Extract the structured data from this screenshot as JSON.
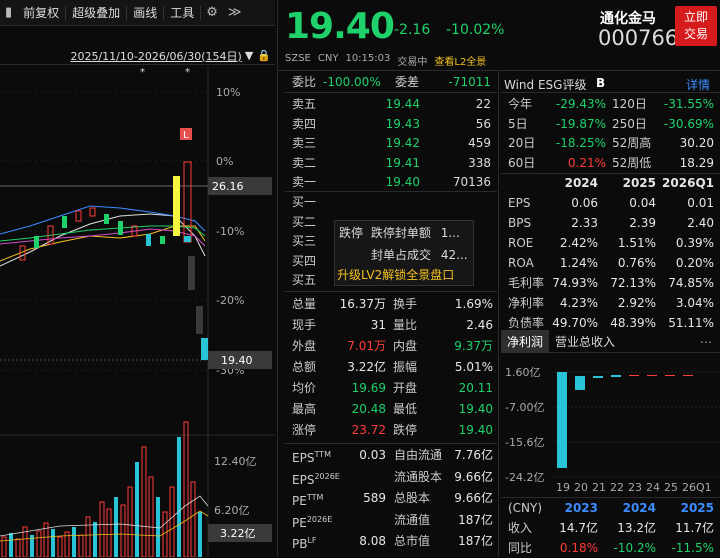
{
  "toolbar": {
    "items": [
      "前复权",
      "超级叠加",
      "画线",
      "工具"
    ],
    "gear": "⚙",
    "collapse": "≫"
  },
  "chart": {
    "range_label": "2025/11/10-2026/06/30(154日)",
    "y_labels": [
      "10%",
      "0%",
      "-10%",
      "-20%",
      "-30%"
    ],
    "price_tags": [
      "26.16",
      "19.40"
    ],
    "vol_labels": [
      "12.40亿",
      "6.20亿",
      "3.22亿"
    ],
    "marker": "L",
    "star": "*"
  },
  "quote": {
    "price": "19.40",
    "change": "-2.16",
    "change_pct": "-10.02%",
    "name": "通化金马",
    "code": "000766",
    "trade_btn": [
      "立即",
      "交易"
    ],
    "sub": [
      "SZSE",
      "CNY",
      "10:15:03",
      "交易中",
      "查看L2全景"
    ]
  },
  "book": {
    "weibi_label": "委比",
    "weibi": "-100.00%",
    "weicha_label": "委差",
    "weicha": "-71011",
    "asks": [
      {
        "label": "卖五",
        "price": "19.44",
        "vol": "22"
      },
      {
        "label": "卖四",
        "price": "19.43",
        "vol": "56"
      },
      {
        "label": "卖三",
        "price": "19.42",
        "vol": "459"
      },
      {
        "label": "卖二",
        "price": "19.41",
        "vol": "338"
      },
      {
        "label": "卖一",
        "price": "19.40",
        "vol": "70136"
      }
    ],
    "bids": [
      "买一",
      "买二",
      "买三",
      "买四",
      "买五"
    ],
    "popup": {
      "l1a": "跌停",
      "l1b": "跌停封单额",
      "l1c": "1...",
      "l2a": "封单占成交",
      "l2b": "42...",
      "l3": "升级LV2解锁全景盘口"
    }
  },
  "stats": [
    {
      "k1": "总量",
      "v1": "16.37万",
      "c1": "white",
      "k2": "换手",
      "v2": "1.69%",
      "c2": "white"
    },
    {
      "k1": "现手",
      "v1": "31",
      "c1": "white",
      "k2": "量比",
      "v2": "2.46",
      "c2": "white"
    },
    {
      "k1": "外盘",
      "v1": "7.01万",
      "c1": "red",
      "k2": "内盘",
      "v2": "9.37万",
      "c2": "green"
    },
    {
      "k1": "总额",
      "v1": "3.22亿",
      "c1": "white",
      "k2": "振幅",
      "v2": "5.01%",
      "c2": "white"
    },
    {
      "k1": "均价",
      "v1": "19.69",
      "c1": "green",
      "k2": "开盘",
      "v2": "20.11",
      "c2": "green"
    },
    {
      "k1": "最高",
      "v1": "20.48",
      "c1": "green",
      "k2": "最低",
      "v2": "19.40",
      "c2": "green"
    },
    {
      "k1": "涨停",
      "v1": "23.72",
      "c1": "red",
      "k2": "跌停",
      "v2": "19.40",
      "c2": "green"
    }
  ],
  "fundamentals": [
    {
      "k1": "EPS",
      "s1": "TTM",
      "v1": "0.03",
      "k2": "自由流通",
      "v2": "7.76亿"
    },
    {
      "k1": "EPS",
      "s1": "2026E",
      "v1": "",
      "k2": "流通股本",
      "v2": "9.66亿"
    },
    {
      "k1": "PE",
      "s1": "TTM",
      "v1": "589",
      "k2": "总股本",
      "v2": "9.66亿"
    },
    {
      "k1": "PE",
      "s1": "2026E",
      "v1": "",
      "k2": "流通值",
      "v2": "187亿"
    },
    {
      "k1": "PB",
      "s1": "LF",
      "v1": "8.08",
      "k2": "总市值",
      "v2": "187亿"
    }
  ],
  "wind": {
    "label": "Wind ESG评级",
    "grade": "B",
    "detail": "详情"
  },
  "perf": [
    {
      "k1": "今年",
      "v1": "-29.43%",
      "c1": "green",
      "k2": "120日",
      "v2": "-31.55%",
      "c2": "green"
    },
    {
      "k1": "5日",
      "v1": "-19.87%",
      "c1": "green",
      "k2": "250日",
      "v2": "-30.69%",
      "c2": "green"
    },
    {
      "k1": "20日",
      "v1": "-18.25%",
      "c1": "green",
      "k2": "52周高",
      "v2": "30.20",
      "c2": "white"
    },
    {
      "k1": "60日",
      "v1": "0.21%",
      "c1": "red",
      "k2": "52周低",
      "v2": "18.29",
      "c2": "white"
    }
  ],
  "fin_table": {
    "headers": [
      "2024",
      "2025",
      "2026Q1"
    ],
    "rows": [
      {
        "k": "EPS",
        "v": [
          "0.06",
          "0.04",
          "0.01"
        ]
      },
      {
        "k": "BPS",
        "v": [
          "2.33",
          "2.39",
          "2.40"
        ]
      },
      {
        "k": "ROE",
        "v": [
          "2.42%",
          "1.51%",
          "0.39%"
        ]
      },
      {
        "k": "ROA",
        "v": [
          "1.24%",
          "0.76%",
          "0.20%"
        ]
      },
      {
        "k": "毛利率",
        "v": [
          "74.93%",
          "72.13%",
          "74.85%"
        ]
      },
      {
        "k": "净利率",
        "v": [
          "4.23%",
          "2.92%",
          "3.04%"
        ]
      },
      {
        "k": "负债率",
        "v": [
          "49.70%",
          "48.39%",
          "51.11%"
        ]
      }
    ]
  },
  "tabs": {
    "active": "净利润",
    "other": "营业总收入"
  },
  "profit_chart": {
    "y_labels": [
      "1.60亿",
      "-7.00亿",
      "-15.6亿",
      "-24.2亿"
    ],
    "x_labels": [
      "19",
      "20",
      "21",
      "22",
      "23",
      "24",
      "25",
      "26Q1"
    ]
  },
  "rev": {
    "headers": [
      "(CNY)",
      "2023",
      "2024",
      "2025"
    ],
    "rows": [
      {
        "k": "收入",
        "v": [
          "14.7亿",
          "13.2亿",
          "11.7亿"
        ],
        "c": [
          "white",
          "white",
          "white"
        ]
      },
      {
        "k": "同比",
        "v": [
          "0.18%",
          "-10.2%",
          "-11.5%"
        ],
        "c": [
          "red",
          "green",
          "green"
        ]
      }
    ]
  }
}
